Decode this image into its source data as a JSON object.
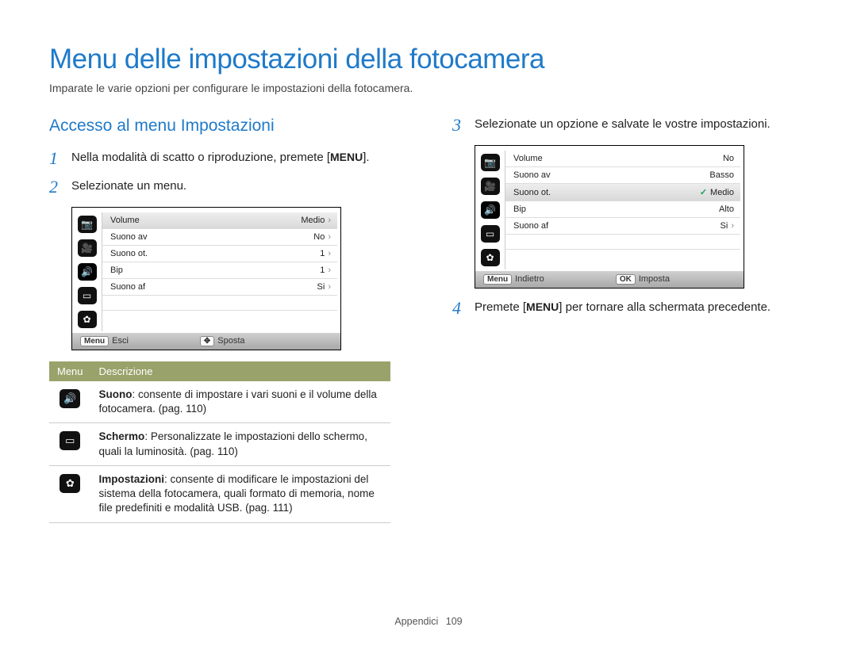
{
  "title": "Menu delle impostazioni della fotocamera",
  "intro": "Imparate le varie opzioni per configurare le impostazioni della fotocamera.",
  "section_title": "Accesso al menu Impostazioni",
  "menu_label": "MENU",
  "steps": {
    "s1_a": "Nella modalità di scatto o riproduzione, premete",
    "s1_b": ".",
    "s2": "Selezionate un menu.",
    "s3": "Selezionate un opzione e salvate le vostre impostazioni.",
    "s4_a": "Premete",
    "s4_b": "per tornare alla schermata precedente."
  },
  "ui1": {
    "rows": [
      {
        "label": "Volume",
        "value": "Medio"
      },
      {
        "label": "Suono av",
        "value": "No"
      },
      {
        "label": "Suono ot.",
        "value": "1"
      },
      {
        "label": "Bip",
        "value": "1"
      },
      {
        "label": "Suono af",
        "value": "Si"
      }
    ],
    "footer_left_btn": "Menu",
    "footer_left": "Esci",
    "footer_right_btn": "✥",
    "footer_right": "Sposta"
  },
  "ui2": {
    "rows": [
      {
        "label": "Volume",
        "value": "No"
      },
      {
        "label": "Suono av",
        "value": "Basso"
      },
      {
        "label": "Suono ot.",
        "value": "Medio",
        "checked": true,
        "highlight": true
      },
      {
        "label": "Bip",
        "value": "Alto"
      },
      {
        "label": "Suono af",
        "value": "Si",
        "chevron": true
      }
    ],
    "footer_left_btn": "Menu",
    "footer_left": "Indietro",
    "footer_right_btn": "OK",
    "footer_right": "Imposta"
  },
  "def_table": {
    "head_menu": "Menu",
    "head_desc": "Descrizione",
    "rows": [
      {
        "icon": "sound",
        "title": "Suono",
        "desc": ": consente di impostare i vari suoni e il volume della fotocamera. (pag. 110)"
      },
      {
        "icon": "screen",
        "title": "Schermo",
        "desc": ": Personalizzate le impostazioni dello schermo, quali la luminosità. (pag. 110)"
      },
      {
        "icon": "gear",
        "title": "Impostazioni",
        "desc": ": consente di modificare le impostazioni del sistema della fotocamera, quali formato di memoria, nome file predefiniti e modalità USB. (pag. 111)"
      }
    ]
  },
  "icons": {
    "camera": "📷",
    "video": "🎥",
    "sound": "🔊",
    "screen": "▭",
    "gear": "✿"
  },
  "footer": {
    "section": "Appendici",
    "page": "109"
  }
}
